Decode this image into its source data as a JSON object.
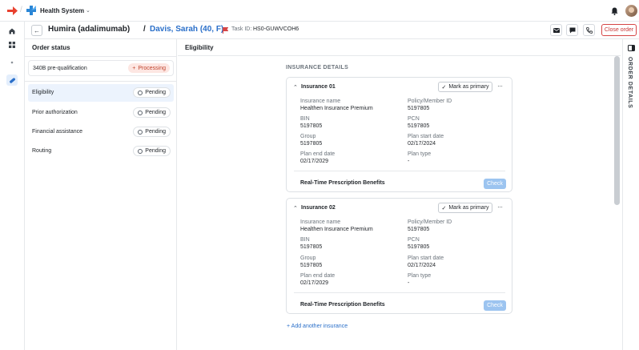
{
  "app": {
    "name": "Health System",
    "brand_red": "#e8412f",
    "brand_blue": "#2a86d6"
  },
  "rail": {
    "items": [
      {
        "name": "home-icon",
        "active": false
      },
      {
        "name": "grid-icon",
        "active": false
      },
      {
        "name": "dot-icon",
        "active": false
      },
      {
        "name": "pill-icon",
        "active": true
      }
    ]
  },
  "task": {
    "drug": "Humira (adalimumab)",
    "separator": "/",
    "patient": "Davis, Sarah (40, F)",
    "task_label": "Task ID:",
    "task_id": "HS0-GUWVCOH6",
    "close_label": "Close order",
    "accent": "#2a6fc9",
    "danger": "#d64545"
  },
  "order_status": {
    "title": "Order status",
    "prequal": {
      "label": "340B pre-qualification",
      "status": "Processing"
    },
    "steps": [
      {
        "label": "Eligibility",
        "status": "Pending",
        "active": true
      },
      {
        "label": "Prior authorization",
        "status": "Pending",
        "active": false
      },
      {
        "label": "Financial assistance",
        "status": "Pending",
        "active": false
      },
      {
        "label": "Routing",
        "status": "Pending",
        "active": false
      }
    ]
  },
  "main": {
    "title": "Eligibility",
    "section_title": "INSURANCE DETAILS",
    "primary_label": "Mark as primary",
    "rtpb_label": "Real-Time Prescription Benefits",
    "check_label": "Check",
    "add_label": "+ Add another insurance",
    "insurances": [
      {
        "title": "Insurance 01",
        "insurance_name_label": "Insurance name",
        "insurance_name": "Healthen Insurance Premium",
        "member_id_label": "Policy/Member ID",
        "member_id": "5197805",
        "bin_label": "BIN",
        "bin": "5197805",
        "pcn_label": "PCN",
        "pcn": "5197805",
        "group_label": "Group",
        "group": "5197805",
        "plan_start_label": "Plan start date",
        "plan_start": "02/17/2024",
        "plan_end_label": "Plan end date",
        "plan_end": "02/17/2029",
        "plan_type_label": "Plan type",
        "plan_type": "-"
      },
      {
        "title": "Insurance 02",
        "insurance_name_label": "Insurance name",
        "insurance_name": "Healthen Insurance Premium",
        "member_id_label": "Policy/Member ID",
        "member_id": "5197805",
        "bin_label": "BIN",
        "bin": "5197805",
        "pcn_label": "PCN",
        "pcn": "5197805",
        "group_label": "Group",
        "group": "5197805",
        "plan_start_label": "Plan start date",
        "plan_start": "02/17/2024",
        "plan_end_label": "Plan end date",
        "plan_end": "02/17/2029",
        "plan_type_label": "Plan type",
        "plan_type": "-"
      }
    ]
  },
  "right_panel": {
    "label": "ORDER DETAILS"
  }
}
